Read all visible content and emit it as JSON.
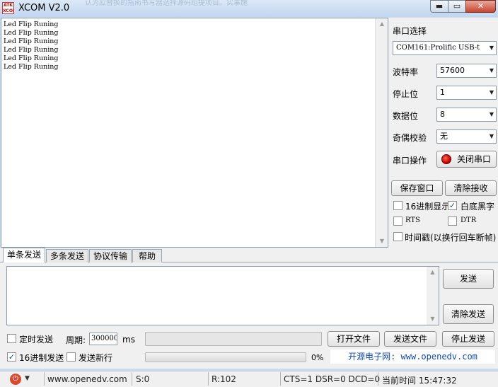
{
  "window": {
    "title": "XCOM V2.0",
    "logo_text": "ATK XCOM",
    "background_blur_text": "认为应替换的指南书写器选择源码组提项目。实事施",
    "min_symbol": "▬",
    "max_symbol": "▭",
    "close_symbol": "✕"
  },
  "receive": {
    "lines": [
      "Led Flip Runing",
      "Led Flip Runing",
      "Led Flip Runing",
      "Led Flip Runing",
      "Led Flip Runing",
      "Led Flip Runing"
    ]
  },
  "serial": {
    "port_label": "串口选择",
    "port_value": "COM161:Prolific USB-t",
    "baud_label": "波特率",
    "baud_value": "57600",
    "stop_label": "停止位",
    "stop_value": "1",
    "data_label": "数据位",
    "data_value": "8",
    "parity_label": "奇偶校验",
    "parity_value": "无",
    "op_label": "串口操作",
    "op_button": "关闭串口"
  },
  "right_buttons": {
    "save_window": "保存窗口",
    "clear_receive": "清除接收"
  },
  "options": {
    "hex_display": {
      "label": "16进制显示",
      "checked": false
    },
    "white_black": {
      "label": "白底黑字",
      "checked": true
    },
    "rts": {
      "label": "RTS",
      "checked": false
    },
    "dtr": {
      "label": "DTR",
      "checked": false
    },
    "timestamp": {
      "label": "时间戳(以换行回车断帧)",
      "checked": false
    }
  },
  "tabs": [
    "单条发送",
    "多条发送",
    "协议传输",
    "帮助"
  ],
  "send": {
    "send_button": "发送",
    "clear_send_button": "清除发送",
    "timed_send": {
      "label": "定时发送",
      "checked": false
    },
    "period_label": "周期:",
    "period_value": "300000",
    "period_unit": "ms",
    "open_file": "打开文件",
    "send_file": "发送文件",
    "stop_send": "停止发送",
    "hex_send": {
      "label": "16进制发送",
      "checked": true
    },
    "newline_send": {
      "label": "发送新行",
      "checked": false
    },
    "progress_text": "0%",
    "promo": "开源电子网: www.openedv.com"
  },
  "status": {
    "website": "www.openedv.com",
    "sent": "S:0",
    "received": "R:102",
    "lines": "CTS=1 DSR=0 DCD=0",
    "time": "当前时间 15:47:32"
  },
  "colors": {
    "promo_text": "#1048c0",
    "close_button": "#c8462f",
    "status_icon": "#d9492f"
  }
}
